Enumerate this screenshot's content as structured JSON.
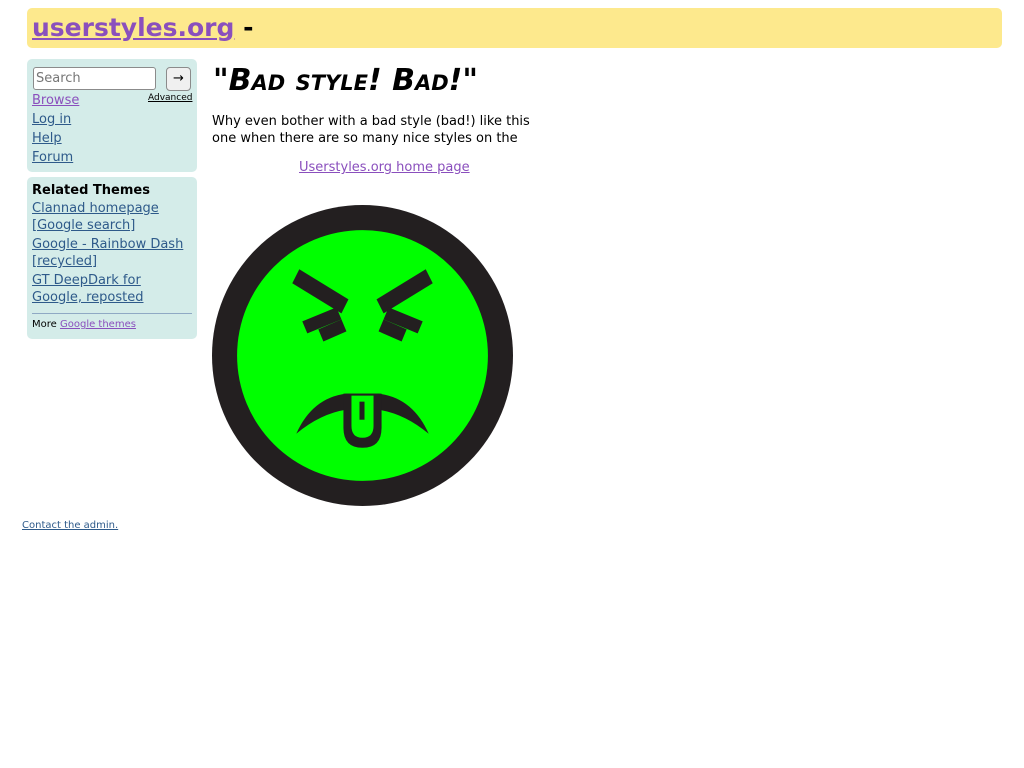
{
  "header": {
    "site_name": "userstyles.org",
    "title_suffix": "-"
  },
  "search": {
    "placeholder": "Search",
    "value": "",
    "submit_label": "→",
    "advanced_label": "Advanced"
  },
  "nav": {
    "items": [
      {
        "label": "Browse"
      },
      {
        "label": "Log in"
      },
      {
        "label": "Help"
      },
      {
        "label": "Forum"
      }
    ]
  },
  "related": {
    "heading": "Related Themes",
    "items": [
      {
        "label": "Clannad homepage [Google search]"
      },
      {
        "label": "Google - Rainbow Dash [recycled]"
      },
      {
        "label": "GT DeepDark for Google, reposted"
      }
    ],
    "more_prefix": "More",
    "more_link": "Google themes"
  },
  "main": {
    "title": "\"Bad style! Bad!\"",
    "text": "Why even bother with a bad style (bad!) like this one when there are so many nice styles on the",
    "home_link": "Userstyles.org home page",
    "image_icon": "mr-yuk-face-icon"
  },
  "footer": {
    "contact": "Contact the admin."
  },
  "colors": {
    "header_bg": "#fde98d",
    "sidebar_bg": "#d4ece9",
    "visited_link": "#8a4fbd",
    "link": "#2e5a8a",
    "face_green": "#00ff00",
    "face_outline": "#231f20"
  }
}
